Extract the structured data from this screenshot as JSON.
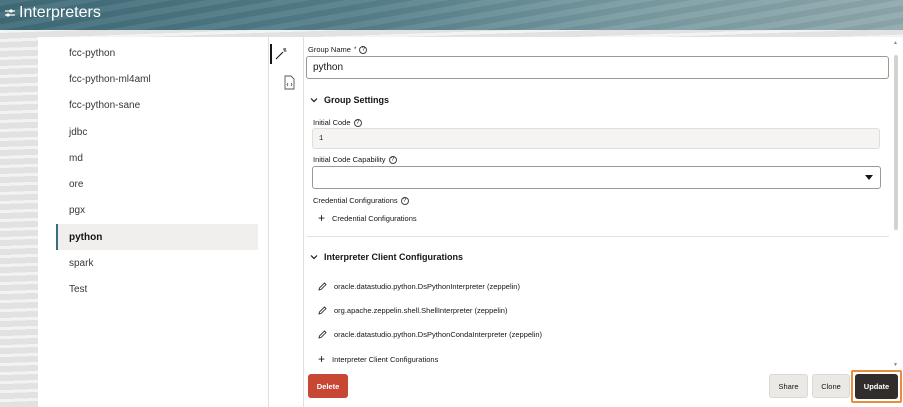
{
  "header": {
    "title": "Interpreters"
  },
  "sidebar": {
    "items": [
      {
        "label": "fcc-python"
      },
      {
        "label": "fcc-python-ml4aml"
      },
      {
        "label": "fcc-python-sane"
      },
      {
        "label": "jdbc"
      },
      {
        "label": "md"
      },
      {
        "label": "ore"
      },
      {
        "label": "pgx"
      },
      {
        "label": "python"
      },
      {
        "label": "spark"
      },
      {
        "label": "Test"
      }
    ],
    "selected": "python"
  },
  "form": {
    "group_name_label": "Group Name",
    "required_mark": "*",
    "group_name_value": "python",
    "group_settings_title": "Group Settings",
    "initial_code_label": "Initial Code",
    "initial_code_value": "1",
    "initial_code_capability_label": "Initial Code Capability",
    "initial_code_capability_value": "",
    "credential_configurations_label": "Credential Configurations",
    "credential_configurations_add": "Credential Configurations",
    "client_configs_title": "Interpreter Client Configurations",
    "client_configs": [
      {
        "label": "oracle.datastudio.python.DsPythonInterpreter (zeppelin)"
      },
      {
        "label": "org.apache.zeppelin.shell.ShellInterpreter (zeppelin)"
      },
      {
        "label": "oracle.datastudio.python.DsPythonCondaInterpreter (zeppelin)"
      }
    ],
    "client_configs_add": "Interpreter Client Configurations"
  },
  "buttons": {
    "delete": "Delete",
    "share": "Share",
    "clone": "Clone",
    "update": "Update"
  },
  "colors": {
    "delete": "#c74634",
    "update": "#312d2a",
    "highlight": "#e98d3c",
    "header": "#4d7985"
  }
}
